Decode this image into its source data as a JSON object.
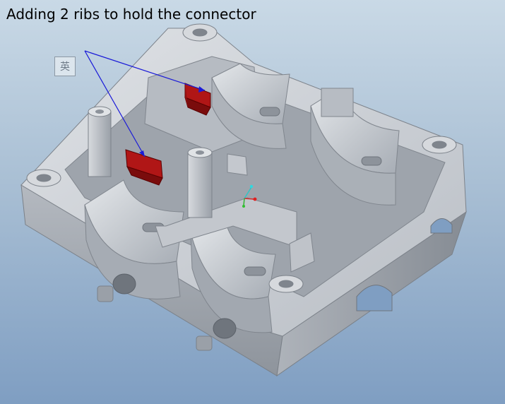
{
  "annotation": {
    "caption": "Adding 2 ribs to hold the connector"
  },
  "ime_indicator": {
    "glyph": "英"
  },
  "colors": {
    "background_top": "#c9d9e6",
    "background_bottom": "#7f9ec2",
    "model_face": "#c8ccd2",
    "model_shadow": "#8f959d",
    "rib_highlight": "#b01616",
    "leader_line": "#1a1ad8"
  },
  "icons": {
    "view_triad": "xyz-triad-icon",
    "model": "cad-part-model"
  }
}
